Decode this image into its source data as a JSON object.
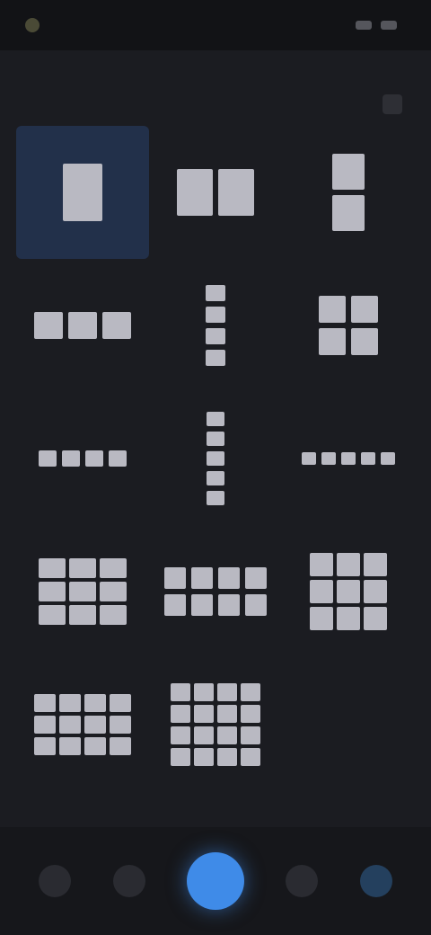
{
  "status_bar": {
    "time": "",
    "battery": ""
  },
  "screen": {
    "title": "",
    "subtitle": ""
  },
  "layouts": [
    {
      "name": "single-tall",
      "cols": 1,
      "rows": 1,
      "cell_w": 44,
      "cell_h": 64,
      "selected": true
    },
    {
      "name": "two-square",
      "cols": 2,
      "rows": 1,
      "cell_w": 40,
      "cell_h": 52,
      "selected": false
    },
    {
      "name": "two-stacked",
      "cols": 1,
      "rows": 2,
      "cell_w": 36,
      "cell_h": 40,
      "selected": false
    },
    {
      "name": "three-row",
      "cols": 3,
      "rows": 1,
      "cell_w": 32,
      "cell_h": 30,
      "selected": false
    },
    {
      "name": "four-stacked",
      "cols": 1,
      "rows": 4,
      "cell_w": 22,
      "cell_h": 18,
      "selected": false
    },
    {
      "name": "two-by-two",
      "cols": 2,
      "rows": 2,
      "cell_w": 30,
      "cell_h": 30,
      "selected": false
    },
    {
      "name": "four-row",
      "cols": 4,
      "rows": 1,
      "cell_w": 20,
      "cell_h": 18,
      "selected": false
    },
    {
      "name": "five-stacked",
      "cols": 1,
      "rows": 5,
      "cell_w": 20,
      "cell_h": 16,
      "selected": false
    },
    {
      "name": "five-row",
      "cols": 5,
      "rows": 1,
      "cell_w": 16,
      "cell_h": 14,
      "selected": false
    },
    {
      "name": "three-by-three",
      "cols": 3,
      "rows": 3,
      "cell_w": 30,
      "cell_h": 22,
      "selected": false
    },
    {
      "name": "four-by-two",
      "cols": 4,
      "rows": 2,
      "cell_w": 24,
      "cell_h": 24,
      "selected": false
    },
    {
      "name": "three-by-three-tall",
      "cols": 3,
      "rows": 3,
      "cell_w": 26,
      "cell_h": 26,
      "selected": false
    },
    {
      "name": "four-by-three",
      "cols": 4,
      "rows": 3,
      "cell_w": 24,
      "cell_h": 20,
      "selected": false
    },
    {
      "name": "four-by-four",
      "cols": 4,
      "rows": 4,
      "cell_w": 22,
      "cell_h": 20,
      "selected": false
    }
  ],
  "bottom_nav": [
    {
      "icon": "home-icon"
    },
    {
      "icon": "gallery-icon"
    },
    {
      "icon": "capture-icon"
    },
    {
      "icon": "edit-icon"
    },
    {
      "icon": "settings-icon"
    }
  ]
}
